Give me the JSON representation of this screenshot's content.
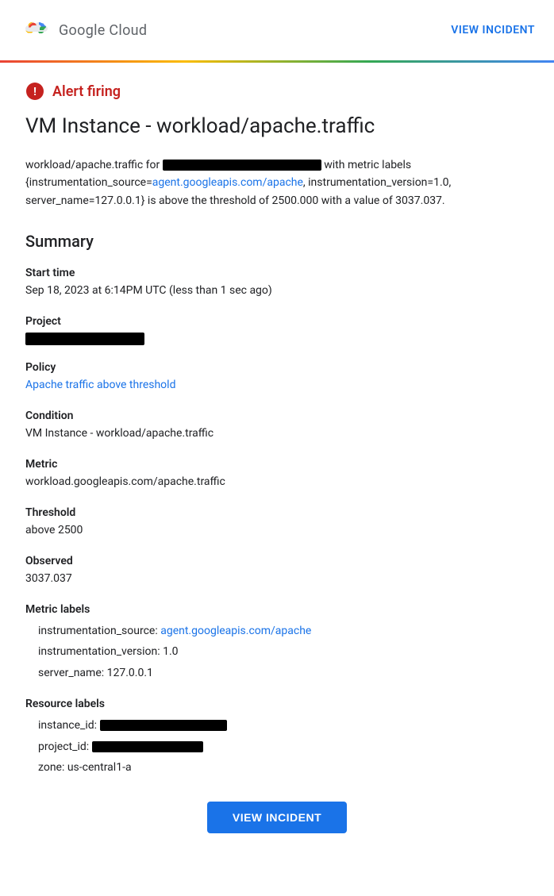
{
  "header": {
    "logo_text": "Google Cloud",
    "view_incident_label": "VIEW INCIDENT"
  },
  "alert": {
    "firing_label": "Alert firing",
    "title": "VM Instance - workload/apache.traffic",
    "description_prefix": "workload/apache.traffic for",
    "description_middle": " with metric labels {instrumentation_source=",
    "instrumentation_link_text": "agent.googleapis.com/apache",
    "instrumentation_link_href": "agent.googleapis.com/apache",
    "description_suffix": ", instrumentation_version=1.0, server_name=127.0.0.1} is above the threshold of 2500.000 with a value of 3037.037."
  },
  "summary": {
    "title": "Summary",
    "start_time_label": "Start time",
    "start_time_value": "Sep 18, 2023 at 6:14PM UTC (less than 1 sec ago)",
    "project_label": "Project",
    "policy_label": "Policy",
    "policy_value": "Apache traffic above threshold",
    "condition_label": "Condition",
    "condition_value": "VM Instance - workload/apache.traffic",
    "metric_label": "Metric",
    "metric_value": "workload.googleapis.com/apache.traffic",
    "threshold_label": "Threshold",
    "threshold_value": "above 2500",
    "observed_label": "Observed",
    "observed_value": "3037.037",
    "metric_labels_title": "Metric labels",
    "metric_labels": [
      {
        "key": "instrumentation_source:",
        "value": "agent.googleapis.com/apache",
        "is_link": true
      },
      {
        "key": "instrumentation_version:",
        "value": "1.0",
        "is_link": false
      },
      {
        "key": "server_name:",
        "value": "127.0.0.1",
        "is_link": false
      }
    ],
    "resource_labels_title": "Resource labels",
    "resource_labels": [
      {
        "key": "instance_id:",
        "value": "",
        "is_redacted": true
      },
      {
        "key": "project_id:",
        "value": "",
        "is_redacted": true
      },
      {
        "key": "zone:",
        "value": "us-central1-a",
        "is_redacted": false
      }
    ]
  },
  "footer": {
    "view_incident_label": "VIEW INCIDENT"
  },
  "colors": {
    "link": "#1a73e8",
    "alert_red": "#c5221f",
    "button_blue": "#1a73e8"
  }
}
